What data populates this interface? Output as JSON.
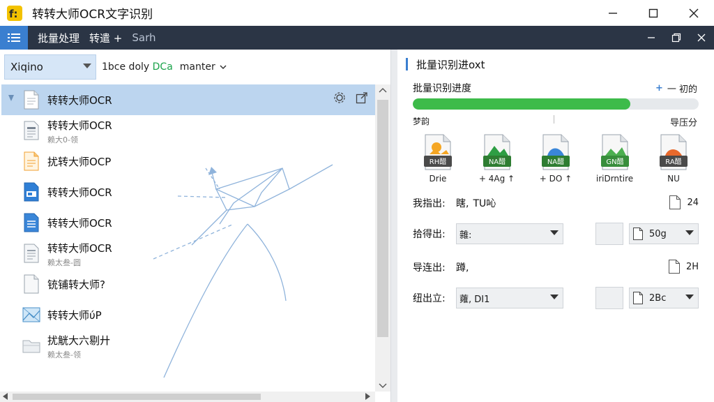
{
  "window": {
    "title": "转转大师OCR文字识别",
    "controls": [
      "minimize",
      "maximize",
      "close"
    ]
  },
  "menubar": {
    "items": [
      {
        "label": "批量处理",
        "dim": false
      },
      {
        "label": "转遣 +",
        "dim": false
      },
      {
        "label": "Sarh",
        "dim": true
      }
    ],
    "right_controls": [
      "minimize",
      "restore",
      "close"
    ]
  },
  "filter": {
    "select_value": "Xiqino",
    "text_prefix": "1bce doly",
    "text_accent": "DCa",
    "branch_label": "manter"
  },
  "files": [
    {
      "name": "转转大师OCR",
      "sub": "",
      "icon": "doc-gray",
      "selected": true
    },
    {
      "name": "转转大师OCR",
      "sub": "赖大0-领",
      "icon": "doc-lines",
      "selected": false
    },
    {
      "name": "扰转大师OCP",
      "sub": "",
      "icon": "doc-orange",
      "selected": false
    },
    {
      "name": "转转大师OCR",
      "sub": "",
      "icon": "doc-blue-card",
      "selected": false
    },
    {
      "name": "转转大师OCR",
      "sub": "",
      "icon": "doc-blue-lines",
      "selected": false
    },
    {
      "name": "转转大师OCR",
      "sub": "赖太叁-圆",
      "icon": "doc-lines",
      "selected": false
    },
    {
      "name": "铳铺转大师?",
      "sub": "",
      "icon": "doc-blank",
      "selected": false
    },
    {
      "name": "转转大师ύP",
      "sub": "",
      "icon": "image",
      "selected": false
    },
    {
      "name": "扰觥大六剔廾",
      "sub": "赖太叁-领",
      "icon": "folder",
      "selected": false
    }
  ],
  "right": {
    "header": "批量识别进oxt",
    "progress": {
      "label": "批量识别进度",
      "ctrl_plus": "+",
      "ctrl_text": "一 初的",
      "fraction": 0.76,
      "left_text": "梦韵",
      "right_text": "导压分"
    },
    "formats": [
      {
        "badge": "RH醋",
        "label": "Drie",
        "color": "#f5a623",
        "badge_bg": "#4a4a4a"
      },
      {
        "badge": "NA醋",
        "label": "+ 4Ag ↑",
        "color": "#2e9e44",
        "badge_bg": "#2e7d32"
      },
      {
        "badge": "NA醋",
        "label": "+ DO ↑",
        "color": "#3a86d8",
        "badge_bg": "#2e7d32"
      },
      {
        "badge": "GN醋",
        "label": "iriDrntire",
        "color": "#4caf50",
        "badge_bg": "#388e3c"
      },
      {
        "badge": "RA醋",
        "label": "NU",
        "color": "#e8692c",
        "badge_bg": "#4a4a4a"
      }
    ],
    "options": [
      {
        "label": "我指出:",
        "text": "瞎,",
        "value": "TU吣",
        "right": "24",
        "type": "text"
      },
      {
        "label": "拾得出:",
        "select": "雜:",
        "size": "50g",
        "type": "select"
      },
      {
        "label": "导连出:",
        "text": "蹲,",
        "right": "2H",
        "type": "text"
      },
      {
        "label": "纽出立:",
        "select": "蕹, DI1",
        "size": "2Bc",
        "type": "select"
      }
    ]
  }
}
